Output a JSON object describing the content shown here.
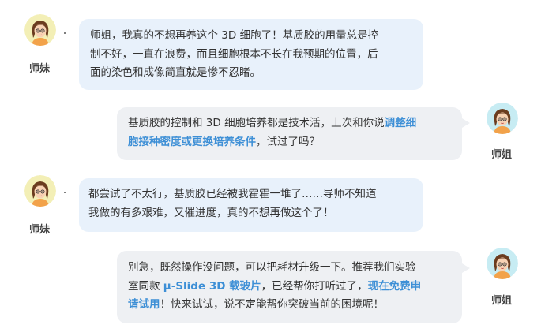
{
  "colors": {
    "left_bubble": "#e8f1fb",
    "right_bubble": "#eef0f3",
    "highlight": "#3d8fd6"
  },
  "messages": [
    {
      "side": "left",
      "speaker": "师妹",
      "avatar": "junior-sister-avatar",
      "lines": [
        [
          {
            "t": "师姐，我真的不想再养这个 3D 细胞了！基质胶的用量总是控"
          }
        ],
        [
          {
            "t": "制不好，一直在浪费，而且细胞根本不长在我预期的位置，后"
          }
        ],
        [
          {
            "t": "面的染色和成像简直就是惨不忍睹。"
          }
        ]
      ]
    },
    {
      "side": "right",
      "speaker": "师姐",
      "avatar": "senior-sister-avatar",
      "lines": [
        [
          {
            "t": "基质胶的控制和 3D 细胞培养都是技术活，上次和你说"
          },
          {
            "t": "调整细",
            "hl": true
          }
        ],
        [
          {
            "t": "胞接种密度或更换培养条件",
            "hl": true
          },
          {
            "t": "，试过了吗？"
          }
        ]
      ]
    },
    {
      "side": "left",
      "speaker": "师妹",
      "avatar": "junior-sister-avatar",
      "lines": [
        [
          {
            "t": "都尝试了不太行，基质胶已经被我霍霍一堆了……导师不知道"
          }
        ],
        [
          {
            "t": "我做的有多艰难，又催进度，真的不想再做这个了！"
          }
        ]
      ]
    },
    {
      "side": "right",
      "speaker": "师姐",
      "avatar": "senior-sister-avatar",
      "lines": [
        [
          {
            "t": "别急，既然操作没问题，可以把耗材升级一下。推荐我们实验"
          }
        ],
        [
          {
            "t": "室同款 "
          },
          {
            "t": "μ-Slide 3D 载玻片",
            "hl": true
          },
          {
            "t": "，已经帮你打听过了，"
          },
          {
            "t": "现在免费申",
            "hl": true
          }
        ],
        [
          {
            "t": "请试用",
            "hl": true
          },
          {
            "t": "！快来试试，说不定能帮你突破当前的困境呢！"
          }
        ]
      ]
    }
  ]
}
